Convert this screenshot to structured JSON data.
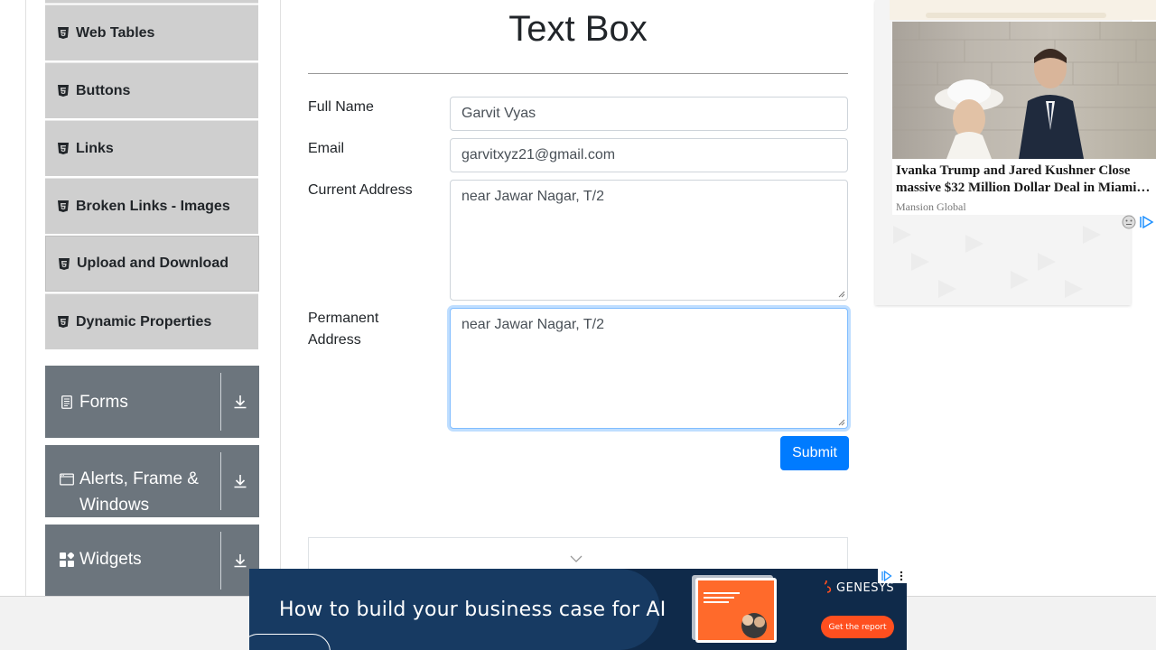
{
  "sidebar": {
    "elements_items": [
      {
        "label": "Web Tables",
        "icon": "html5-icon"
      },
      {
        "label": "Buttons",
        "icon": "html5-icon"
      },
      {
        "label": "Links",
        "icon": "html5-icon"
      },
      {
        "label": "Broken Links - Images",
        "icon": "html5-icon"
      },
      {
        "label": "Upload and Download",
        "icon": "html5-icon"
      },
      {
        "label": "Dynamic Properties",
        "icon": "html5-icon"
      }
    ],
    "groups": [
      {
        "label": "Forms",
        "icon": "form-icon"
      },
      {
        "label": "Alerts, Frame & Windows",
        "icon": "window-icon"
      },
      {
        "label": "Widgets",
        "icon": "widgets-icon"
      }
    ]
  },
  "main": {
    "title": "Text Box",
    "form": {
      "full_name_label": "Full Name",
      "full_name_value": "Garvit Vyas",
      "email_label": "Email",
      "email_value": "garvitxyz21@gmail.com",
      "current_address_label": "Current Address",
      "current_address_value": "near Jawar Nagar, T/2",
      "permanent_address_label": "Permanent Address",
      "permanent_address_value": "near Jawar Nagar, T/2",
      "submit_label": "Submit"
    }
  },
  "ad_right": {
    "headline": "Ivanka Trump and Jared Kushner Close massive $32 Million Dollar Deal in Miami…",
    "source": "Mansion Global"
  },
  "ad_bottom": {
    "headline": "How to build your business case for AI",
    "brand": "GENESYS",
    "cta": "Get the report"
  },
  "colors": {
    "primary": "#007bff",
    "sidebar_group": "#6c757d",
    "sidebar_item": "#cfcfcf"
  }
}
